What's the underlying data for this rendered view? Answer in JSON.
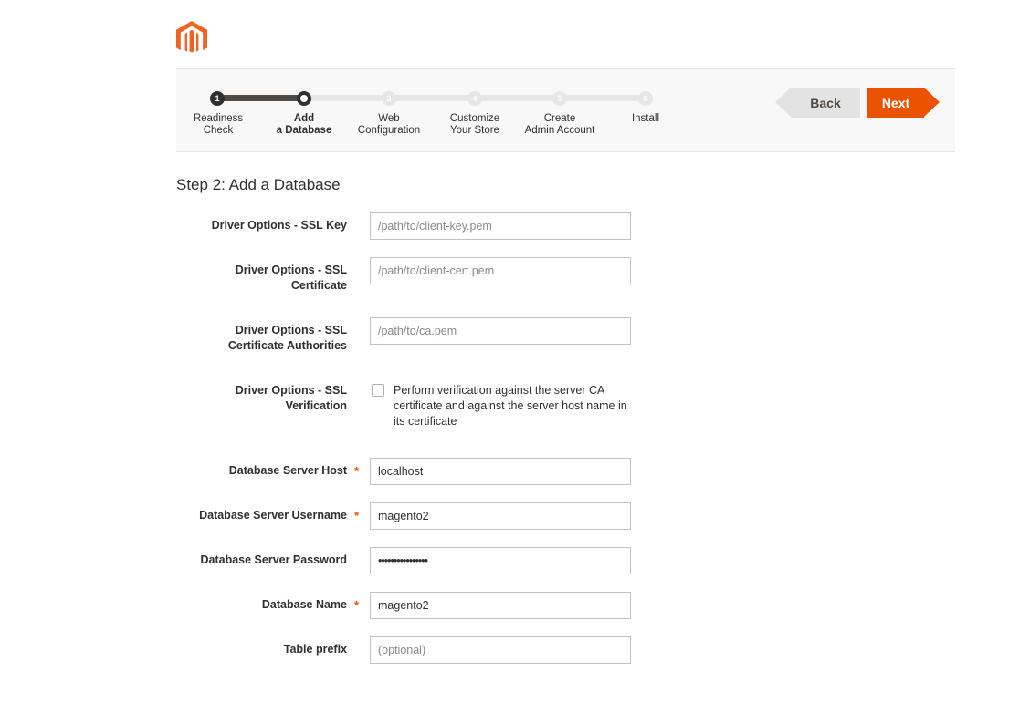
{
  "brand": {
    "logo": "magento-logo-icon",
    "accent_color": "#eb5202"
  },
  "progress": {
    "current_step": 2,
    "steps": [
      {
        "number": "1",
        "line1": "Readiness",
        "line2": "Check",
        "state": "done"
      },
      {
        "number": "2",
        "line1": "Add",
        "line2": "a Database",
        "state": "current"
      },
      {
        "number": "3",
        "line1": "Web",
        "line2": "Configuration",
        "state": "pending"
      },
      {
        "number": "4",
        "line1": "Customize",
        "line2": "Your Store",
        "state": "pending"
      },
      {
        "number": "5",
        "line1": "Create",
        "line2": "Admin Account",
        "state": "pending"
      },
      {
        "number": "6",
        "line1": "Install",
        "line2": "",
        "state": "pending"
      }
    ]
  },
  "nav": {
    "back_label": "Back",
    "next_label": "Next"
  },
  "page_title": "Step 2: Add a Database",
  "fields": {
    "ssl_key": {
      "label": "Driver Options - SSL Key",
      "value": "",
      "placeholder": "/path/to/client-key.pem"
    },
    "ssl_cert": {
      "label_line1": "Driver Options - SSL",
      "label_line2": "Certificate",
      "value": "",
      "placeholder": "/path/to/client-cert.pem"
    },
    "ssl_ca": {
      "label_line1": "Driver Options - SSL",
      "label_line2": "Certificate Authorities",
      "value": "",
      "placeholder": "/path/to/ca.pem"
    },
    "ssl_verify": {
      "label_line1": "Driver Options - SSL",
      "label_line2": "Verification",
      "checked": false,
      "description": "Perform verification against the server CA certificate and against the server host name in its certificate"
    },
    "db_host": {
      "label": "Database Server Host",
      "required_mark": "*",
      "value": "localhost",
      "placeholder": ""
    },
    "db_user": {
      "label": "Database Server Username",
      "required_mark": "*",
      "value": "magento2",
      "placeholder": ""
    },
    "db_password": {
      "label": "Database Server Password",
      "value": "••••••••••••••••",
      "placeholder": ""
    },
    "db_name": {
      "label": "Database Name",
      "required_mark": "*",
      "value": "magento2",
      "placeholder": ""
    },
    "table_prefix": {
      "label": "Table prefix",
      "value": "",
      "placeholder": "(optional)"
    }
  }
}
